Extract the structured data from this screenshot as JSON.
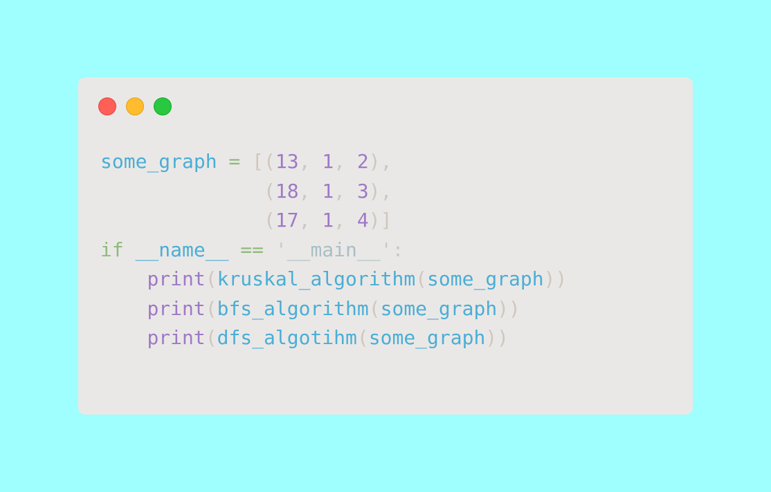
{
  "window": {
    "traffic_lights": [
      {
        "name": "close",
        "color": "#fe5f57"
      },
      {
        "name": "minimize",
        "color": "#febc2e"
      },
      {
        "name": "maximize",
        "color": "#28c840"
      }
    ]
  },
  "code": {
    "lines": [
      [
        {
          "text": "some_graph",
          "cls": "t-ident"
        },
        {
          "text": " = ",
          "cls": "t-op"
        },
        {
          "text": "[(",
          "cls": "t-punct"
        },
        {
          "text": "13",
          "cls": "t-num"
        },
        {
          "text": ", ",
          "cls": "t-punct"
        },
        {
          "text": "1",
          "cls": "t-num"
        },
        {
          "text": ", ",
          "cls": "t-punct"
        },
        {
          "text": "2",
          "cls": "t-num"
        },
        {
          "text": "),",
          "cls": "t-punct"
        }
      ],
      [
        {
          "text": "              ",
          "cls": ""
        },
        {
          "text": "(",
          "cls": "t-punct"
        },
        {
          "text": "18",
          "cls": "t-num"
        },
        {
          "text": ", ",
          "cls": "t-punct"
        },
        {
          "text": "1",
          "cls": "t-num"
        },
        {
          "text": ", ",
          "cls": "t-punct"
        },
        {
          "text": "3",
          "cls": "t-num"
        },
        {
          "text": "),",
          "cls": "t-punct"
        }
      ],
      [
        {
          "text": "              ",
          "cls": ""
        },
        {
          "text": "(",
          "cls": "t-punct"
        },
        {
          "text": "17",
          "cls": "t-num"
        },
        {
          "text": ", ",
          "cls": "t-punct"
        },
        {
          "text": "1",
          "cls": "t-num"
        },
        {
          "text": ", ",
          "cls": "t-punct"
        },
        {
          "text": "4",
          "cls": "t-num"
        },
        {
          "text": ")]",
          "cls": "t-punct"
        }
      ],
      [
        {
          "text": "if",
          "cls": "t-kw"
        },
        {
          "text": " ",
          "cls": ""
        },
        {
          "text": "__name__",
          "cls": "t-dunder"
        },
        {
          "text": " == ",
          "cls": "t-op"
        },
        {
          "text": "'",
          "cls": "t-quote"
        },
        {
          "text": "__main__",
          "cls": "t-str"
        },
        {
          "text": "'",
          "cls": "t-quote"
        },
        {
          "text": ":",
          "cls": "t-punct"
        }
      ],
      [
        {
          "text": "    ",
          "cls": ""
        },
        {
          "text": "print",
          "cls": "t-builtin"
        },
        {
          "text": "(",
          "cls": "t-punct"
        },
        {
          "text": "kruskal_algorithm",
          "cls": "t-func"
        },
        {
          "text": "(",
          "cls": "t-punct"
        },
        {
          "text": "some_graph",
          "cls": "t-ident"
        },
        {
          "text": "))",
          "cls": "t-punct"
        }
      ],
      [
        {
          "text": "    ",
          "cls": ""
        },
        {
          "text": "print",
          "cls": "t-builtin"
        },
        {
          "text": "(",
          "cls": "t-punct"
        },
        {
          "text": "bfs_algorithm",
          "cls": "t-func"
        },
        {
          "text": "(",
          "cls": "t-punct"
        },
        {
          "text": "some_graph",
          "cls": "t-ident"
        },
        {
          "text": "))",
          "cls": "t-punct"
        }
      ],
      [
        {
          "text": "    ",
          "cls": ""
        },
        {
          "text": "print",
          "cls": "t-builtin"
        },
        {
          "text": "(",
          "cls": "t-punct"
        },
        {
          "text": "dfs_algotihm",
          "cls": "t-func"
        },
        {
          "text": "(",
          "cls": "t-punct"
        },
        {
          "text": "some_graph",
          "cls": "t-ident"
        },
        {
          "text": "))",
          "cls": "t-punct"
        }
      ]
    ]
  }
}
